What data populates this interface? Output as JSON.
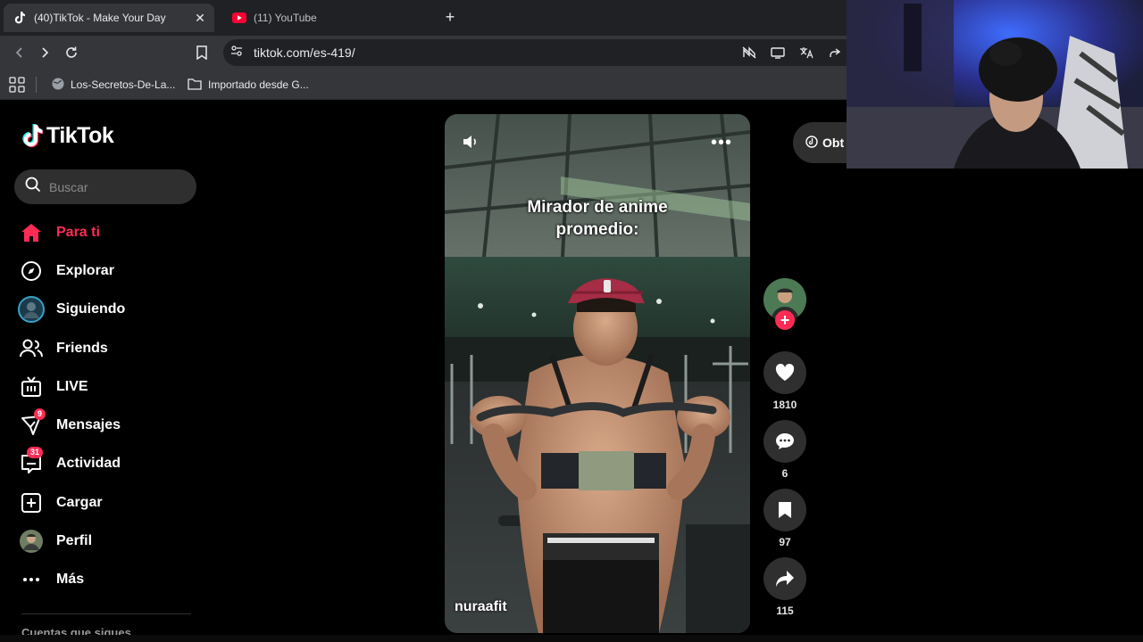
{
  "browser": {
    "tabs": [
      {
        "title": "(40)TikTok - Make Your Day",
        "active": true
      },
      {
        "title": "(11) YouTube",
        "active": false
      }
    ],
    "url": "tiktok.com/es-419/",
    "bookmarks": [
      {
        "label": "Los-Secretos-De-La..."
      },
      {
        "label": "Importado desde G..."
      }
    ]
  },
  "tiktok": {
    "logo": "TikTok",
    "search_placeholder": "Buscar",
    "nav": [
      {
        "label": "Para ti",
        "icon": "home-icon",
        "active": true
      },
      {
        "label": "Explorar",
        "icon": "compass-icon"
      },
      {
        "label": "Siguiendo",
        "icon": "following-avatar-icon"
      },
      {
        "label": "Friends",
        "icon": "friends-icon"
      },
      {
        "label": "LIVE",
        "icon": "live-tv-icon"
      },
      {
        "label": "Mensajes",
        "icon": "messages-icon",
        "badge": "9"
      },
      {
        "label": "Actividad",
        "icon": "activity-icon",
        "badge": "31"
      },
      {
        "label": "Cargar",
        "icon": "upload-icon"
      },
      {
        "label": "Perfil",
        "icon": "profile-avatar-icon"
      },
      {
        "label": "Más",
        "icon": "more-dots-icon"
      }
    ],
    "following_section": "Cuentas que sigues",
    "get_app": "Obt",
    "video": {
      "caption_line1": "Mirador de anime",
      "caption_line2": "promedio:",
      "username": "nuraafit"
    },
    "actions": {
      "likes": "1810",
      "comments": "6",
      "saves": "97",
      "shares": "115"
    }
  },
  "colors": {
    "accent": "#fe2c55",
    "background": "#000000",
    "chip": "#2f2f2f"
  }
}
